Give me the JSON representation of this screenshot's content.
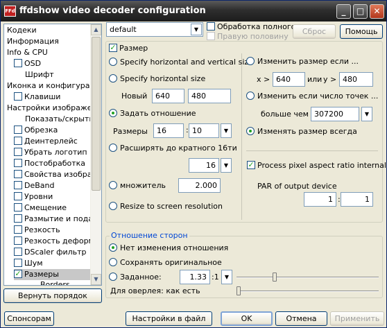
{
  "window": {
    "title": "ffdshow video decoder configuration",
    "app_icon_text": "FFd"
  },
  "titlebar": {
    "minimize": "_",
    "maximize": "□",
    "close": "✕"
  },
  "sidebar": {
    "items": [
      {
        "label": "Кодеки"
      },
      {
        "label": "Информация"
      },
      {
        "label": "Info & CPU"
      },
      {
        "label": "OSD"
      },
      {
        "label": "Шрифт"
      },
      {
        "label": "Иконка и конфигурация"
      },
      {
        "label": "Клавиши"
      },
      {
        "label": "Настройки изображения"
      },
      {
        "label": "Показать/скрыть о"
      },
      {
        "label": "Обрезка"
      },
      {
        "label": "Деинтерлейс"
      },
      {
        "label": "Убрать логотип"
      },
      {
        "label": "Постобработка"
      },
      {
        "label": "Свойства изображ"
      },
      {
        "label": "DeBand"
      },
      {
        "label": "Уровни"
      },
      {
        "label": "Смещение"
      },
      {
        "label": "Размытие и подав"
      },
      {
        "label": "Резкость"
      },
      {
        "label": "Резкость деформа"
      },
      {
        "label": "DScaler фильтр"
      },
      {
        "label": "Шум"
      },
      {
        "label": "Размеры"
      },
      {
        "label": "Borders"
      }
    ],
    "restore_order_button": "Вернуть порядок"
  },
  "top": {
    "preset_value": "default",
    "full_processing_label": "Обработка полного",
    "right_half_label": "Правую половину",
    "reset_button": "Сброс",
    "help_button": "Помощь"
  },
  "resize": {
    "enabled_label": "Размер",
    "specify_hv": "Specify horizontal and vertical size",
    "specify_h": "Specify horizontal size",
    "new_label": "Новый",
    "new_w": "640",
    "new_h": "480",
    "set_ratio": "Задать отношение",
    "sizes_label": "Размеры",
    "ratio_a": "16",
    "ratio_sep": ":",
    "ratio_b": "10",
    "expand_multiple": "Расширять до кратного 16ти",
    "multiple_value": "16",
    "multiplier": "множитель",
    "multiplier_value": "2.000",
    "fit_screen": "Resize to screen resolution"
  },
  "conditions": {
    "resize_if": "Изменить размер если ...",
    "x_prefix": "x",
    "gt": ">",
    "x_value": "640",
    "or_label": "или",
    "y_prefix": "y",
    "y_value": "480",
    "resize_if_pixels": "Изменить если число точек ...",
    "more_than": "больше чем",
    "pixels_value": "307200",
    "resize_always": "Изменять размер всегда",
    "process_par": "Process pixel aspect ratio internally",
    "par_label": "PAR of output device",
    "par_a": "1",
    "par_sep": ":",
    "par_b": "1"
  },
  "aspect": {
    "group_title": "Отношение сторон",
    "no_change": "Нет изменения отношения",
    "keep_original": "Сохранять оригинальное",
    "manual": "Заданное:",
    "manual_value": "1.33",
    "manual_suffix": ":1",
    "overlay_label": "Для оверлея: как есть",
    "manual_slider": 0.26,
    "overlay_slider": 0.0
  },
  "bottom": {
    "sponsors": "Спонсорам",
    "save_to_file": "Настройки в файл",
    "ok": "OK",
    "cancel": "Отмена",
    "apply": "Применить"
  },
  "icons": {
    "dropdown": "▼",
    "scroll_up": "▲",
    "scroll_down": "▼",
    "check": "✓"
  }
}
